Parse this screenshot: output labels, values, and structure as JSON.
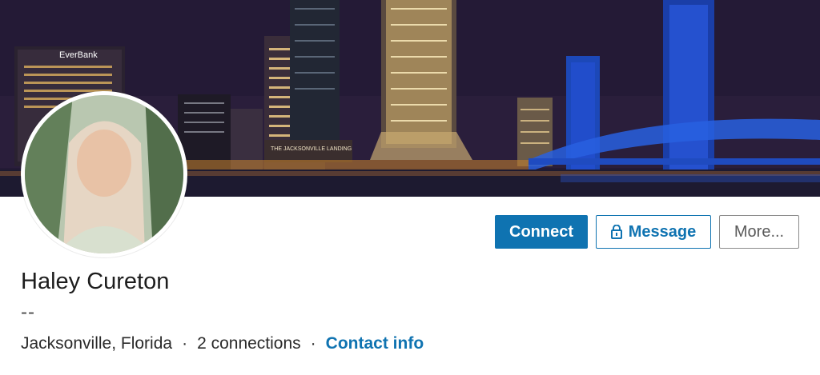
{
  "profile": {
    "name": "Haley Cureton",
    "headline": "--",
    "location": "Jacksonville, Florida",
    "connections": "2 connections",
    "contact_info": "Contact info",
    "separator": "·"
  },
  "cover": {
    "signs": [
      "EverBank",
      "THE JACKSONVILLE LANDING"
    ]
  },
  "actions": {
    "connect_label": "Connect",
    "message_label": "Message",
    "more_label": "More..."
  },
  "colors": {
    "primary": "#0f73b1",
    "more_border": "#8c8c8c",
    "text": "#1d1d1d"
  },
  "icons": {
    "message": "lock-icon"
  }
}
